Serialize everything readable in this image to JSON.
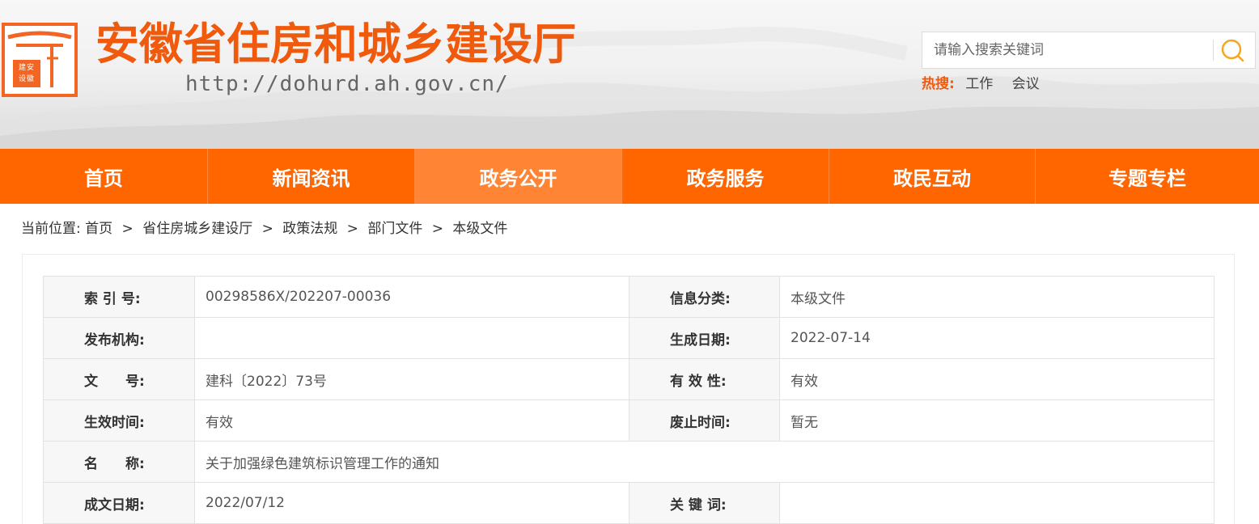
{
  "header": {
    "site_title": "安徽省住房和城乡建设厅",
    "site_url": "http://dohurd.ah.gov.cn/",
    "logo_seal_text": "建安设徽",
    "brand_color": "#f05a0c",
    "search": {
      "placeholder": "请输入搜索关键词",
      "value": ""
    },
    "hot_search": {
      "label": "热搜:",
      "items": [
        "工作",
        "会议"
      ]
    }
  },
  "nav": {
    "bar_color": "#ff6600",
    "items": [
      {
        "label": "首页",
        "active": false
      },
      {
        "label": "新闻资讯",
        "active": false
      },
      {
        "label": "政务公开",
        "active": true
      },
      {
        "label": "政务服务",
        "active": false
      },
      {
        "label": "政民互动",
        "active": false
      },
      {
        "label": "专题专栏",
        "active": false
      }
    ]
  },
  "breadcrumb": {
    "prefix": "当前位置:",
    "items": [
      "首页",
      "省住房城乡建设厅",
      "政策法规",
      "部门文件",
      "本级文件"
    ],
    "separator": ">"
  },
  "info": {
    "rows": [
      {
        "l1": "索 引 号:",
        "v1": "00298586X/202207-00036",
        "l2": "信息分类:",
        "v2": "本级文件"
      },
      {
        "l1": "发布机构:",
        "v1": "",
        "l2": "生成日期:",
        "v2": "2022-07-14"
      },
      {
        "l1": "文　　号:",
        "v1": "建科〔2022〕73号",
        "l2": "有 效 性:",
        "v2": "有效"
      },
      {
        "l1": "生效时间:",
        "v1": "有效",
        "l2": "废止时间:",
        "v2": "暂无"
      }
    ],
    "name_row": {
      "label": "名　　称:",
      "value": "关于加强绿色建筑标识管理工作的通知"
    },
    "last_row": {
      "l1": "成文日期:",
      "v1": "2022/07/12",
      "l2": "关 键 词:",
      "v2": ""
    }
  }
}
